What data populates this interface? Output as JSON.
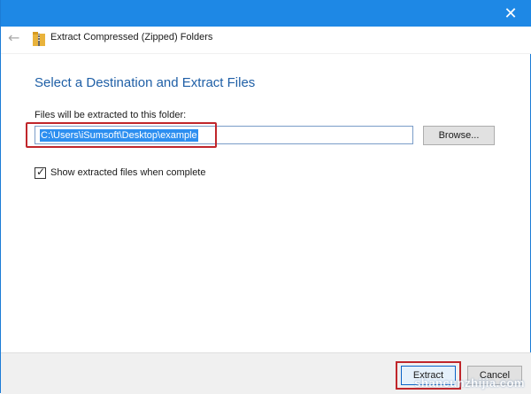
{
  "window": {
    "title": "Extract Compressed (Zipped) Folders",
    "close_glyph": "✕",
    "back_glyph": "←"
  },
  "content": {
    "heading": "Select a Destination and Extract Files",
    "folder_label": "Files will be extracted to this folder:",
    "path_value": "C:\\Users\\iSumsoft\\Desktop\\example",
    "browse_label": "Browse...",
    "show_files_label": "Show extracted files when complete",
    "show_files_checked": true
  },
  "footer": {
    "extract_label": "Extract",
    "cancel_label": "Cancel"
  },
  "watermark": "shancunzhijia.com",
  "colors": {
    "title_bar": "#1e88e5",
    "heading": "#1f5fa6",
    "highlight": "#c0262b",
    "selection": "#2d8ff0"
  },
  "icons": [
    "close-icon",
    "back-arrow-icon",
    "zip-folder-icon",
    "checkmark-icon"
  ]
}
